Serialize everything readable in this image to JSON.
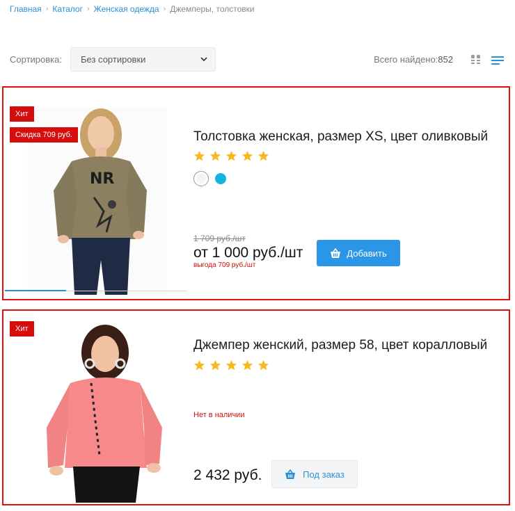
{
  "breadcrumb": {
    "items": [
      "Главная",
      "Каталог",
      "Женская одежда"
    ],
    "current": "Джемперы, толстовки"
  },
  "sort": {
    "label": "Сортировка:",
    "selected": "Без сортировки"
  },
  "results": {
    "label": "Всего найдено:",
    "count": "852"
  },
  "colors": {
    "accent": "#2b96e8",
    "badge": "#d50d0d",
    "star": "#f7b820",
    "highlight_border": "#e01010"
  },
  "products": [
    {
      "badges": [
        "Хит",
        "Скидка 709 руб."
      ],
      "title": "Толстовка женская, размер XS, цвет оливковый",
      "rating": 5,
      "colors": [
        "#ffffff",
        "#14b3e3"
      ],
      "old_price": "1 709 руб./шт",
      "price": "от 1 000 руб./шт",
      "savings": "выгода 709 руб./шт",
      "button": "Добавить"
    },
    {
      "badges": [
        "Хит"
      ],
      "title": "Джемпер женский, размер 58, цвет коралловый",
      "rating": 5,
      "stock": "Нет в наличии",
      "price": "2 432 руб.",
      "button": "Под заказ"
    }
  ]
}
